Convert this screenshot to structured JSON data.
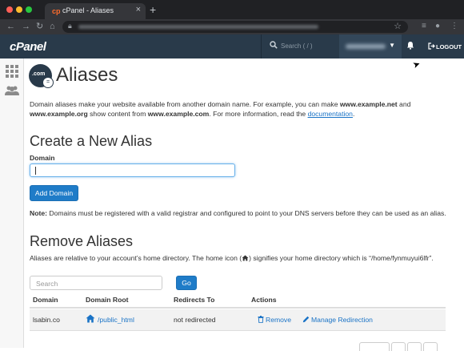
{
  "browser": {
    "tab_title": "cPanel - Aliases",
    "tab_icon": "cp",
    "close_glyph": "×",
    "new_tab_glyph": "+",
    "traffic_lights": [
      "#ff5f57",
      "#febc2e",
      "#28c840"
    ]
  },
  "header": {
    "logo": "cPanel",
    "search_placeholder": "Search ( / )",
    "logout_label": "LOGOUT"
  },
  "page": {
    "title": "Aliases",
    "title_icon_text": ".com",
    "intro_1": "Domain aliases make your website available from another domain name. For example, you can make ",
    "intro_example_net": "www.example.net",
    "intro_2": " and ",
    "intro_example_org": "www.example.org",
    "intro_3": " show content from ",
    "intro_example_com": "www.example.com",
    "intro_4": ". For more information, read the ",
    "intro_link": "documentation",
    "intro_5": "."
  },
  "create": {
    "heading": "Create a New Alias",
    "domain_label": "Domain",
    "domain_value": "",
    "add_button": "Add Domain",
    "note_label": "Note:",
    "note_text": " Domains must be registered with a valid registrar and configured to point to your DNS servers before they can be used as an alias."
  },
  "remove": {
    "heading": "Remove Aliases",
    "hint_1": "Aliases are relative to your account’s home directory. The home icon (",
    "hint_2": ") signifies your home directory which is “/home/fynmuyui6lfr”.",
    "search_placeholder": "Search",
    "go_button": "Go",
    "columns": [
      "Domain",
      "Domain Root",
      "Redirects To",
      "Actions"
    ],
    "rows": [
      {
        "domain": "lsabin.co",
        "root": "/public_html",
        "redirects": "not redirected",
        "remove_label": "Remove",
        "manage_label": "Manage Redirection"
      }
    ]
  },
  "colors": {
    "header_bg": "#293a4a",
    "primary": "#1f7cc8",
    "link": "#1a73c6"
  }
}
